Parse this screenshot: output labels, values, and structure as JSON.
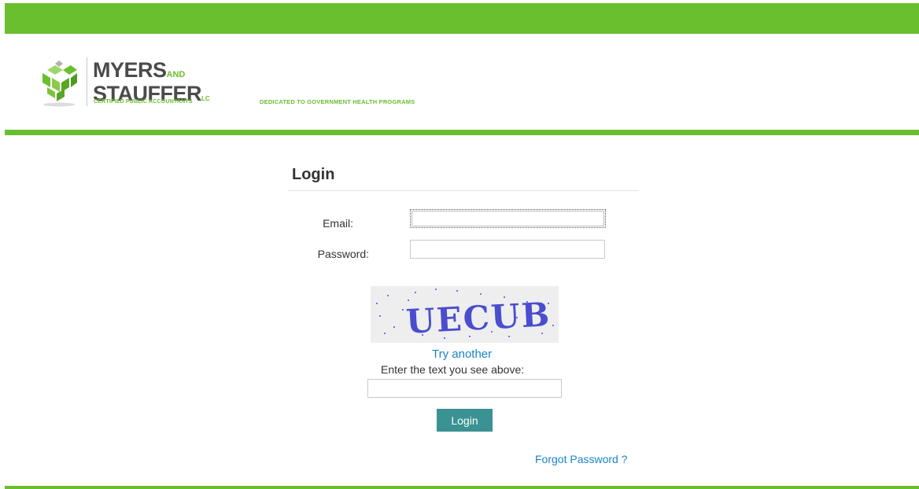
{
  "header": {
    "logo_word_1": "MYERS",
    "logo_word_and": "AND",
    "logo_word_2": "STAUFFER",
    "logo_word_lc": "LC",
    "logo_subtitle": "CERTIFIED PUBLIC ACCOUNTANTS",
    "tagline": "DEDICATED TO GOVERNMENT HEALTH PROGRAMS",
    "brand_color": "#6abf2e"
  },
  "login": {
    "title": "Login",
    "email_label": "Email:",
    "email_value": "",
    "password_label": "Password:",
    "password_value": "",
    "captcha_text": "UECUB",
    "try_another": "Try another",
    "captcha_prompt": "Enter the text you see above:",
    "captcha_value": "",
    "submit_label": "Login",
    "forgot_password": "Forgot Password ?"
  }
}
